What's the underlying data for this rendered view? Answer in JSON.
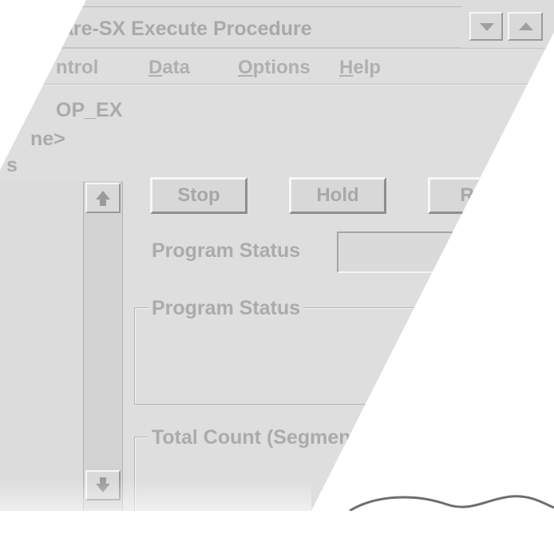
{
  "window": {
    "title": "are-SX Execute Procedure"
  },
  "menu": {
    "items": [
      {
        "text": "ntrol"
      },
      {
        "text": "Data",
        "mnemonic": "D",
        "rest": "ata"
      },
      {
        "text": "Options",
        "mnemonic": "O",
        "rest": "ptions"
      },
      {
        "text": "Help",
        "mnemonic": "H",
        "rest": "elp"
      }
    ]
  },
  "info": {
    "line1": "OP_EX",
    "line2": "ne>",
    "line3": "s"
  },
  "buttons": {
    "stop": "Stop",
    "hold": "Hold",
    "run": "Rur"
  },
  "program_status": {
    "label": "Program Status",
    "value": ""
  },
  "groups": {
    "program_status_legend": "Program Status",
    "total_count_legend": "Total Count (Segment"
  },
  "icons": {
    "scroll_up": "arrow-up-icon",
    "scroll_down": "arrow-down-icon",
    "minimize": "triangle-down-icon",
    "maximize": "triangle-up-icon"
  }
}
